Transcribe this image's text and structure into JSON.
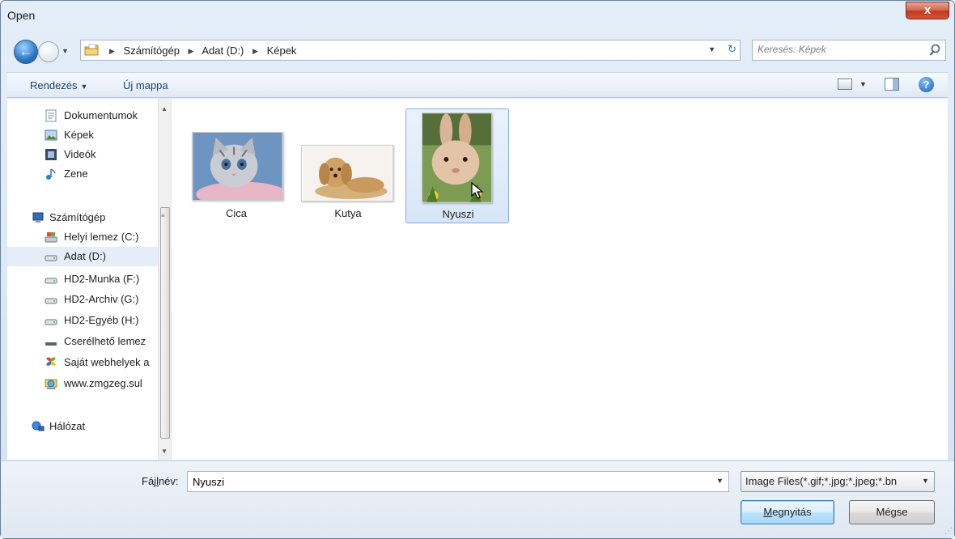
{
  "window": {
    "title": "Open",
    "close_label": "x"
  },
  "navigation": {
    "breadcrumbs": [
      "Számítógép",
      "Adat (D:)",
      "Képek"
    ],
    "search_placeholder": "Keresés: Képek"
  },
  "toolbar": {
    "organize_label": "Rendezés",
    "new_folder_label": "Új mappa",
    "help_label": "?"
  },
  "sidebar": {
    "items": [
      {
        "label": "Dokumentumok",
        "icon": "documents-icon"
      },
      {
        "label": "Képek",
        "icon": "pictures-icon"
      },
      {
        "label": "Videók",
        "icon": "videos-icon"
      },
      {
        "label": "Zene",
        "icon": "music-icon"
      },
      {
        "label": "Számítógép",
        "icon": "computer-icon"
      },
      {
        "label": "Helyi lemez (C:)",
        "icon": "system-drive-icon"
      },
      {
        "label": "Adat (D:)",
        "icon": "drive-icon",
        "selected": true
      },
      {
        "label": "HD2-Munka (F:)",
        "icon": "drive-icon"
      },
      {
        "label": "HD2-Archiv (G:)",
        "icon": "drive-icon"
      },
      {
        "label": "HD2-Egyéb (H:)",
        "icon": "drive-icon"
      },
      {
        "label": "Cserélhető lemez",
        "icon": "removable-drive-icon"
      },
      {
        "label": "Saját webhelyek a",
        "icon": "web-folder-icon"
      },
      {
        "label": "www.zmgzeg.sul",
        "icon": "network-location-icon"
      },
      {
        "label": "Hálózat",
        "icon": "network-icon"
      }
    ]
  },
  "files": [
    {
      "name": "Cica",
      "thumbnail": "kitten-photo"
    },
    {
      "name": "Kutya",
      "thumbnail": "puppy-photo"
    },
    {
      "name": "Nyuszi",
      "thumbnail": "bunny-photo",
      "selected": true
    }
  ],
  "bottom": {
    "filename_label_pre": "Fáj",
    "filename_label_u": "l",
    "filename_label_post": "név:",
    "filename_value": "Nyuszi",
    "filetype_value": "Image Files(*.gif;*.jpg;*.jpeg;*.bn",
    "open_label_u": "M",
    "open_label_rest": "egnyitás",
    "cancel_label": "Mégse"
  }
}
